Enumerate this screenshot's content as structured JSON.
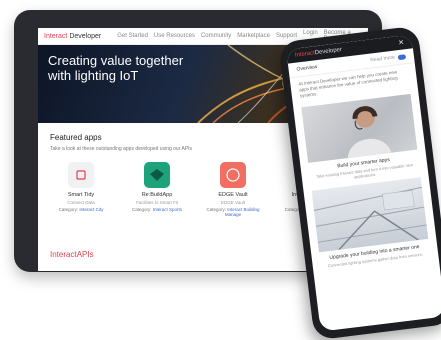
{
  "tablet": {
    "brand_main": "Interact",
    "brand_sub": "Developer",
    "nav": [
      "Get Started",
      "Use Resources",
      "Community",
      "Marketplace",
      "Support"
    ],
    "nav_right": [
      "Login",
      "Become a Partner"
    ],
    "hero_title": "Creating value together with lighting IoT",
    "featured_title": "Featured apps",
    "featured_subtitle": "Take a look at these outstanding apps developed using our APIs",
    "apps": [
      {
        "name": "Smart Tidy",
        "sub": "Connect Data",
        "cat_label": "Category:",
        "cat_value": "Interact City",
        "color": "#f1f1f4"
      },
      {
        "name": "Re:BuildApp",
        "sub": "Facilities to Smart Fit",
        "cat_label": "Category:",
        "cat_value": "Interact Sports",
        "color": "#1ea27b"
      },
      {
        "name": "EDGE Vault",
        "sub": "EDGE Vault",
        "cat_label": "Category:",
        "cat_value": "Interact Building Manage",
        "color": "#f06e62"
      },
      {
        "name": "Inventory Plus",
        "sub": "Inventory",
        "cat_label": "Category:",
        "cat_value": "Interact Retail",
        "color": "#2a8fd6"
      }
    ],
    "apis_main": "Interact",
    "apis_sub": "APIs"
  },
  "phone": {
    "brand_main": "Interact",
    "brand_sub": "Developer",
    "row_label": "Overview",
    "row_right": "Read more",
    "text": "At Interact Developer we can help you create new apps that enhance the value of connected lighting systems.",
    "caption1": "Build your smarter apps",
    "small1": "Take existing Interact data and turn it into valuable new applications.",
    "caption2": "Upgrade your building into a smarter one",
    "small2": "Connected lighting systems gather data from sensors."
  },
  "colors": {
    "accent_red": "#e4414f",
    "link_blue": "#3a6fc4",
    "tablet_frame": "#2a2b30",
    "phone_frame": "#1d1e22"
  }
}
